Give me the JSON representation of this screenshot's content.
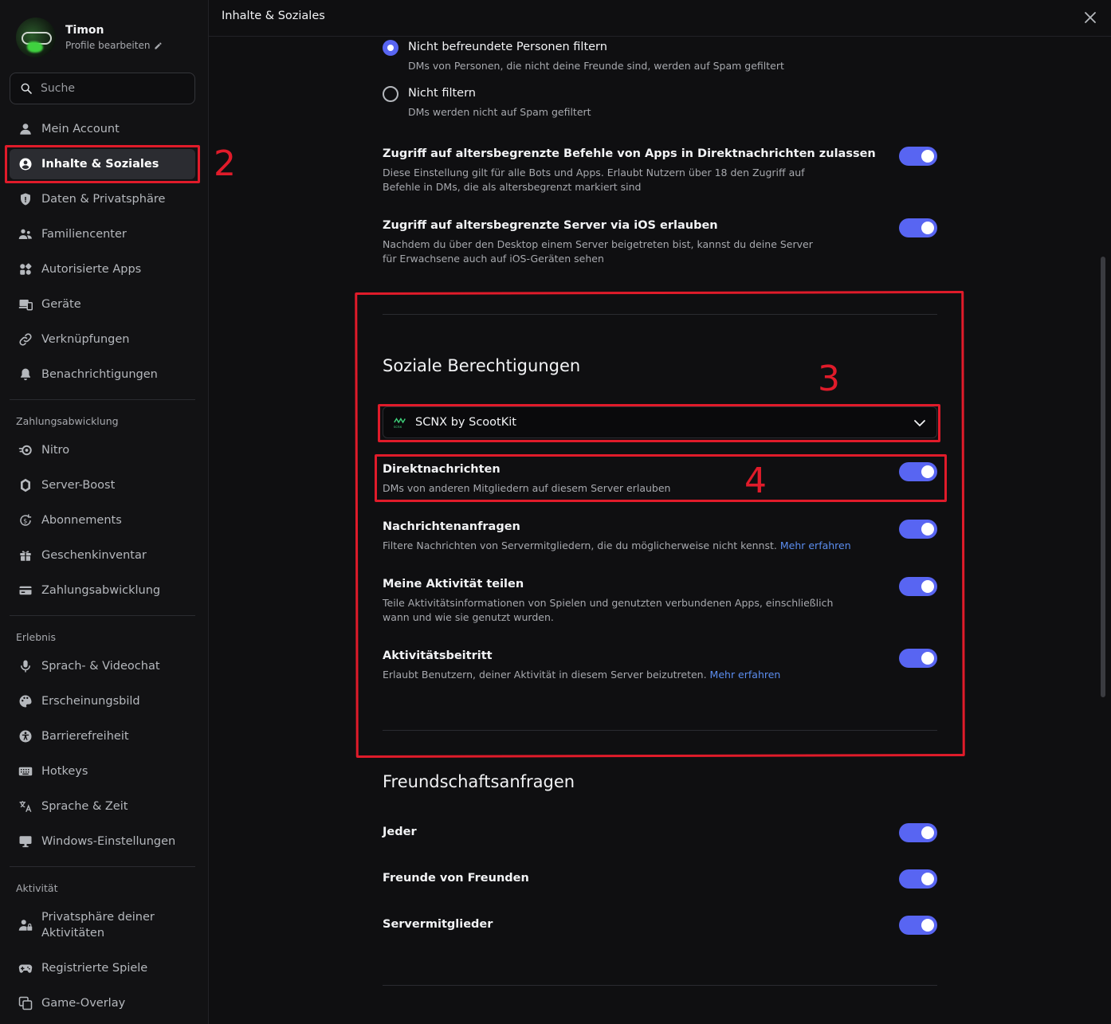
{
  "profile": {
    "name": "Timon",
    "edit_label": "Profile bearbeiten"
  },
  "search": {
    "placeholder": "Suche"
  },
  "sidebar": {
    "top_items": [
      {
        "label": "Mein Account",
        "icon": "user-icon"
      },
      {
        "label": "Inhalte & Soziales",
        "icon": "content-social-icon"
      },
      {
        "label": "Daten & Privatsphäre",
        "icon": "shield-icon"
      },
      {
        "label": "Familiencenter",
        "icon": "family-icon"
      },
      {
        "label": "Autorisierte Apps",
        "icon": "apps-icon"
      },
      {
        "label": "Geräte",
        "icon": "devices-icon"
      },
      {
        "label": "Verknüpfungen",
        "icon": "link-icon"
      },
      {
        "label": "Benachrichtigungen",
        "icon": "bell-icon"
      }
    ],
    "billing_label": "Zahlungsabwicklung",
    "billing_items": [
      {
        "label": "Nitro",
        "icon": "nitro-icon"
      },
      {
        "label": "Server-Boost",
        "icon": "boost-icon"
      },
      {
        "label": "Abonnements",
        "icon": "subscription-icon"
      },
      {
        "label": "Geschenkinventar",
        "icon": "gift-icon"
      },
      {
        "label": "Zahlungsabwicklung",
        "icon": "card-icon"
      }
    ],
    "experience_label": "Erlebnis",
    "experience_items": [
      {
        "label": "Sprach- & Videochat",
        "icon": "mic-icon"
      },
      {
        "label": "Erscheinungsbild",
        "icon": "palette-icon"
      },
      {
        "label": "Barrierefreiheit",
        "icon": "accessibility-icon"
      },
      {
        "label": "Hotkeys",
        "icon": "keyboard-icon"
      },
      {
        "label": "Sprache & Zeit",
        "icon": "translate-icon"
      },
      {
        "label": "Windows-Einstellungen",
        "icon": "monitor-icon"
      }
    ],
    "activity_label": "Aktivität",
    "activity_items": [
      {
        "label": "Privatsphäre deiner Aktivitäten",
        "icon": "activity-privacy-icon"
      },
      {
        "label": "Registrierte Spiele",
        "icon": "gamepad-icon"
      },
      {
        "label": "Game-Overlay",
        "icon": "overlay-icon"
      }
    ]
  },
  "header": {
    "title": "Inhalte & Soziales"
  },
  "dm_filter": {
    "options": [
      {
        "title": "Nicht befreundete Personen filtern",
        "desc": "DMs von Personen, die nicht deine Freunde sind, werden auf Spam gefiltert",
        "checked": true
      },
      {
        "title": "Nicht filtern",
        "desc": "DMs werden nicht auf Spam gefiltert",
        "checked": false
      }
    ]
  },
  "age_settings": [
    {
      "title": "Zugriff auf altersbegrenzte Befehle von Apps in Direktnachrichten zulassen",
      "desc": "Diese Einstellung gilt für alle Bots und Apps. Erlaubt Nutzern über 18 den Zugriff auf Befehle in DMs, die als altersbegrenzt markiert sind",
      "enabled": true
    },
    {
      "title": "Zugriff auf altersbegrenzte Server via iOS erlauben",
      "desc": "Nachdem du über den Desktop einem Server beigetreten bist, kannst du deine Server für Erwachsene auch auf iOS-Geräten sehen",
      "enabled": true
    }
  ],
  "social_permissions": {
    "heading": "Soziale Berechtigungen",
    "server_select": {
      "value": "SCNX by ScootKit",
      "icon_text": "scnx"
    },
    "items": [
      {
        "title": "Direktnachrichten",
        "desc": "DMs von anderen Mitgliedern auf diesem Server erlauben",
        "link": "",
        "enabled": true
      },
      {
        "title": "Nachrichtenanfragen",
        "desc": "Filtere Nachrichten von Servermitgliedern, die du möglicherweise nicht kennst.",
        "link": "Mehr erfahren",
        "enabled": true
      },
      {
        "title": "Meine Aktivität teilen",
        "desc": "Teile Aktivitätsinformationen von Spielen und genutzten verbundenen Apps, einschließlich wann und wie sie genutzt wurden.",
        "link": "",
        "enabled": true
      },
      {
        "title": "Aktivitätsbeitritt",
        "desc": "Erlaubt Benutzern, deiner Aktivität in diesem Server beizutreten.",
        "link": "Mehr erfahren",
        "enabled": true
      }
    ]
  },
  "friend_requests": {
    "heading": "Freundschaftsanfragen",
    "items": [
      {
        "title": "Jeder",
        "enabled": true
      },
      {
        "title": "Freunde von Freunden",
        "enabled": true
      },
      {
        "title": "Servermitglieder",
        "enabled": true
      }
    ]
  },
  "annotations": {
    "num2": "2",
    "num3": "3",
    "num4": "4",
    "color": "#e01b2a"
  },
  "colors": {
    "accent": "#5865f2",
    "link": "#5b8def",
    "background": "#0f0f11",
    "sidebar": "#121214"
  }
}
